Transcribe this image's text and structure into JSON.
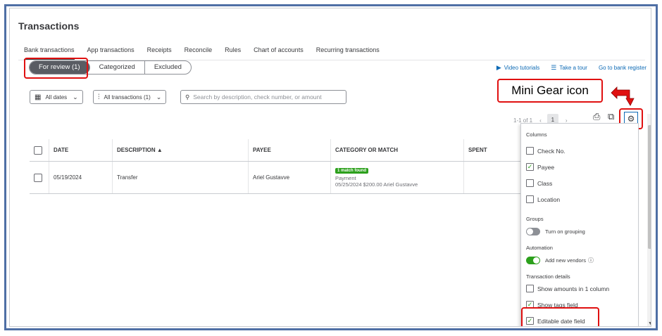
{
  "page": {
    "title": "Transactions"
  },
  "tabs": [
    "Bank transactions",
    "App transactions",
    "Receipts",
    "Reconcile",
    "Rules",
    "Chart of accounts",
    "Recurring transactions"
  ],
  "segments": [
    "For review (1)",
    "Categorized",
    "Excluded"
  ],
  "toplinks": {
    "video": "Video tutorials",
    "tour": "Take a tour",
    "register": "Go to bank register"
  },
  "filters": {
    "dates": "All dates",
    "transactions": "All transactions (1)",
    "search_placeholder": "Search by description, check number, or amount"
  },
  "callout": "Mini Gear icon",
  "pager": {
    "range": "1-1 of 1",
    "current": "1"
  },
  "table": {
    "headers": [
      "DATE",
      "DESCRIPTION ▲",
      "PAYEE",
      "CATEGORY OR MATCH",
      "SPENT"
    ],
    "rows": [
      {
        "date": "05/19/2024",
        "description": "Transfer",
        "payee": "Ariel Gustavve",
        "badge": "1 match found",
        "match_type": "Payment",
        "match_detail": "05/25/2024 $200.00 Ariel Gustavve"
      }
    ]
  },
  "settings": {
    "columns_label": "Columns",
    "columns": [
      {
        "label": "Check No.",
        "checked": false
      },
      {
        "label": "Payee",
        "checked": true
      },
      {
        "label": "Class",
        "checked": false
      },
      {
        "label": "Location",
        "checked": false
      }
    ],
    "groups_label": "Groups",
    "grouping_label": "Turn on grouping",
    "automation_label": "Automation",
    "vendors_label": "Add new vendors",
    "details_label": "Transaction details",
    "details": [
      {
        "label": "Show amounts in 1 column",
        "checked": false
      },
      {
        "label": "Show tags field",
        "checked": true
      },
      {
        "label": "Editable date field",
        "checked": true
      }
    ]
  },
  "colors": {
    "accent_green": "#2ca01c",
    "link_blue": "#0d6ab5",
    "highlight_red": "#e01010"
  }
}
